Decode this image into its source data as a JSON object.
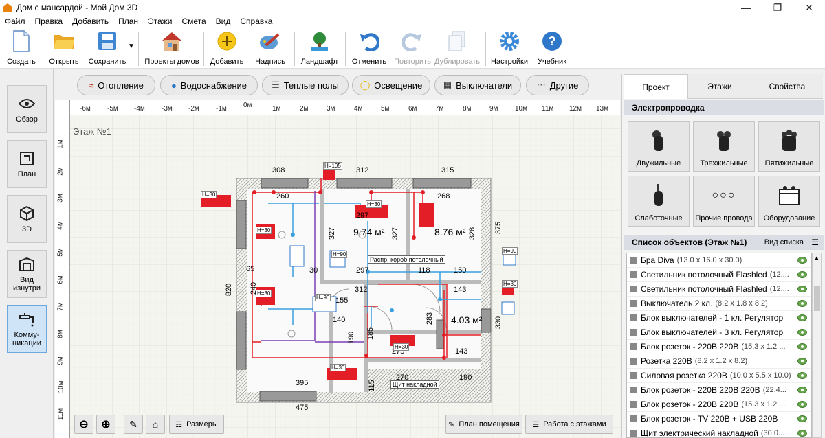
{
  "window": {
    "title": "Дом с мансардой - Мой Дом 3D"
  },
  "menu": [
    "Файл",
    "Правка",
    "Добавить",
    "План",
    "Этажи",
    "Смета",
    "Вид",
    "Справка"
  ],
  "toolbar": {
    "create": "Создать",
    "open": "Открыть",
    "save": "Сохранить",
    "house_projects": "Проекты домов",
    "add": "Добавить",
    "label": "Надпись",
    "landscape": "Ландшафт",
    "undo": "Отменить",
    "redo": "Повторить",
    "duplicate": "Дублировать",
    "settings": "Настройки",
    "tutorial": "Учебник"
  },
  "left_nav": {
    "overview": "Обзор",
    "plan": "План",
    "view3d": "3D",
    "inside": "Вид изнутри",
    "comms": "Комму-никации"
  },
  "categories": [
    "Отопление",
    "Водоснабжение",
    "Теплые полы",
    "Освещение",
    "Выключатели",
    "Другие"
  ],
  "ruler": {
    "top": [
      "-6м",
      "-5м",
      "-4м",
      "-3м",
      "-2м",
      "-1м",
      "0м",
      "1м",
      "2м",
      "3м",
      "4м",
      "5м",
      "6м",
      "7м",
      "8м",
      "9м",
      "10м",
      "11м",
      "12м",
      "13м"
    ],
    "left": [
      "1м",
      "2м",
      "3м",
      "4м",
      "5м",
      "6м",
      "7м",
      "8м",
      "9м",
      "10м",
      "11м"
    ]
  },
  "plan": {
    "floor_label": "Этаж №1",
    "dims": [
      "308",
      "312",
      "315",
      "260",
      "297",
      "268",
      "327",
      "327",
      "328",
      "375",
      "820",
      "65",
      "240",
      "30",
      "297",
      "118",
      "150",
      "312",
      "143",
      "155",
      "140",
      "190",
      "185",
      "283",
      "330",
      "143",
      "275",
      "270",
      "190",
      "395",
      "115",
      "475"
    ],
    "area_a": "9.74 м²",
    "area_b": "8.76 м²",
    "area_c": "4.03 м²",
    "h_tags": [
      "H=105",
      "H=30",
      "H=30",
      "H=30",
      "H=90",
      "H=90",
      "H=90",
      "H=30",
      "H=30",
      "H=30",
      "H=30"
    ],
    "callout_box": "Распр. короб потолочный",
    "callout_panel": "Щит накладной"
  },
  "canvas_buttons": {
    "sizes": "Размеры",
    "room_plan": "План помещения",
    "floors_work": "Работа с этажами"
  },
  "right": {
    "tabs": [
      "Проект",
      "Этажи",
      "Свойства"
    ],
    "section_wiring": "Электропроводка",
    "wires": [
      "Двужильные",
      "Трехжильные",
      "Пятижильные",
      "Слаботочные",
      "Прочие провода",
      "Оборудование"
    ],
    "objects_title": "Список объектов (Этаж №1)",
    "view_list": "Вид списка",
    "objects": [
      {
        "name": "Бра Diva",
        "dims": "(13.0 x 16.0 x 30.0)"
      },
      {
        "name": "Светильник потолочный Flashled",
        "dims": "(12...."
      },
      {
        "name": "Светильник потолочный Flashled",
        "dims": "(12...."
      },
      {
        "name": "Выключатель 2 кл.",
        "dims": "(8.2 x 1.8 x 8.2)"
      },
      {
        "name": "Блок выключателей - 1 кл. Регулятор",
        "dims": ""
      },
      {
        "name": "Блок выключателей - 3 кл. Регулятор",
        "dims": ""
      },
      {
        "name": "Блок розеток - 220В 220В",
        "dims": "(15.3 x 1.2 ..."
      },
      {
        "name": "Розетка 220В",
        "dims": "(8.2 x 1.2 x 8.2)"
      },
      {
        "name": "Силовая розетка 220В",
        "dims": "(10.0 x 5.5 x 10.0)"
      },
      {
        "name": "Блок розеток - 220В 220В 220В",
        "dims": "(22.4..."
      },
      {
        "name": "Блок розеток - 220В 220В",
        "dims": "(15.3 x 1.2 ..."
      },
      {
        "name": "Блок розеток - TV 220В + USB 220В",
        "dims": ""
      },
      {
        "name": "Щит электрический накладной",
        "dims": "(30.0..."
      }
    ]
  },
  "colors": {
    "accent": "#e41e26",
    "wire_blue": "#3aa0e0",
    "wire_purple": "#7b3fb5",
    "grid": "#e2e2d8"
  }
}
